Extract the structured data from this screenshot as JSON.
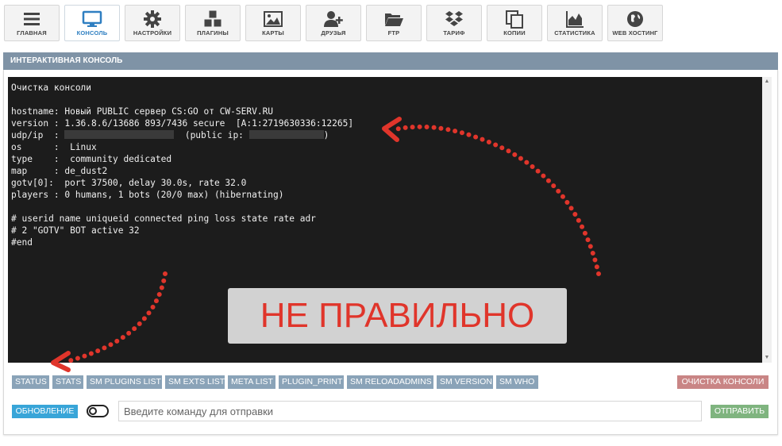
{
  "nav": [
    {
      "label": "ГЛАВНАЯ",
      "icon": "menu-icon"
    },
    {
      "label": "КОНСОЛЬ",
      "icon": "monitor-icon",
      "active": true
    },
    {
      "label": "НАСТРОЙКИ",
      "icon": "gear-icon"
    },
    {
      "label": "ПЛАГИНЫ",
      "icon": "cubes-icon"
    },
    {
      "label": "КАРТЫ",
      "icon": "image-icon"
    },
    {
      "label": "ДРУЗЬЯ",
      "icon": "user-add-icon"
    },
    {
      "label": "FTP",
      "icon": "folder-open-icon"
    },
    {
      "label": "ТАРИФ",
      "icon": "dropbox-icon"
    },
    {
      "label": "КОПИИ",
      "icon": "copy-icon"
    },
    {
      "label": "СТАТИСТИКА",
      "icon": "area-chart-icon"
    },
    {
      "label": "WEB ХОСТИНГ",
      "icon": "globe-icon"
    }
  ],
  "panel": {
    "title": "ИНТЕРАКТИВНАЯ КОНСОЛЬ"
  },
  "console": {
    "line_clear": "Очистка консоли",
    "hostname": "hostname: Новый PUBLIC сервер CS:GO от CW-SERV.RU",
    "version": "version : 1.36.8.6/13686 893/7436 secure  [A:1:2719630336:12265]",
    "udp_prefix": "udp/ip  : ",
    "udp_mid": "  (public ip: ",
    "udp_suffix": ")",
    "os": "os      :  Linux",
    "type": "type    :  community dedicated",
    "map": "map     : de_dust2",
    "gotv": "gotv[0]:  port 37500, delay 30.0s, rate 32.0",
    "players": "players : 0 humans, 1 bots (20/0 max) (hibernating)",
    "header": "# userid name uniqueid connected ping loss state rate adr",
    "row": "# 2 \"GOTV\" BOT active 32",
    "end": "#end"
  },
  "stamp": "НЕ ПРАВИЛЬНО",
  "commands": [
    "STATUS",
    "STATS",
    "SM PLUGINS LIST",
    "SM EXTS LIST",
    "META LIST",
    "PLUGIN_PRINT",
    "SM RELOADADMINS",
    "SM VERSION",
    "SM WHO"
  ],
  "clear_label": "ОЧИСТКА КОНСОЛИ",
  "refresh_label": "ОБНОВЛЕНИЕ",
  "input": {
    "placeholder": "Введите команду для отправки",
    "value": ""
  },
  "send_label": "ОТПРАВИТЬ",
  "colors": {
    "header": "#7f93a6",
    "command": "#8aa3b8",
    "clear": "#c98585",
    "refresh": "#38a5d8",
    "send": "#7fb47f",
    "stamp_text": "#e0352b",
    "arrow": "#e0352b"
  }
}
